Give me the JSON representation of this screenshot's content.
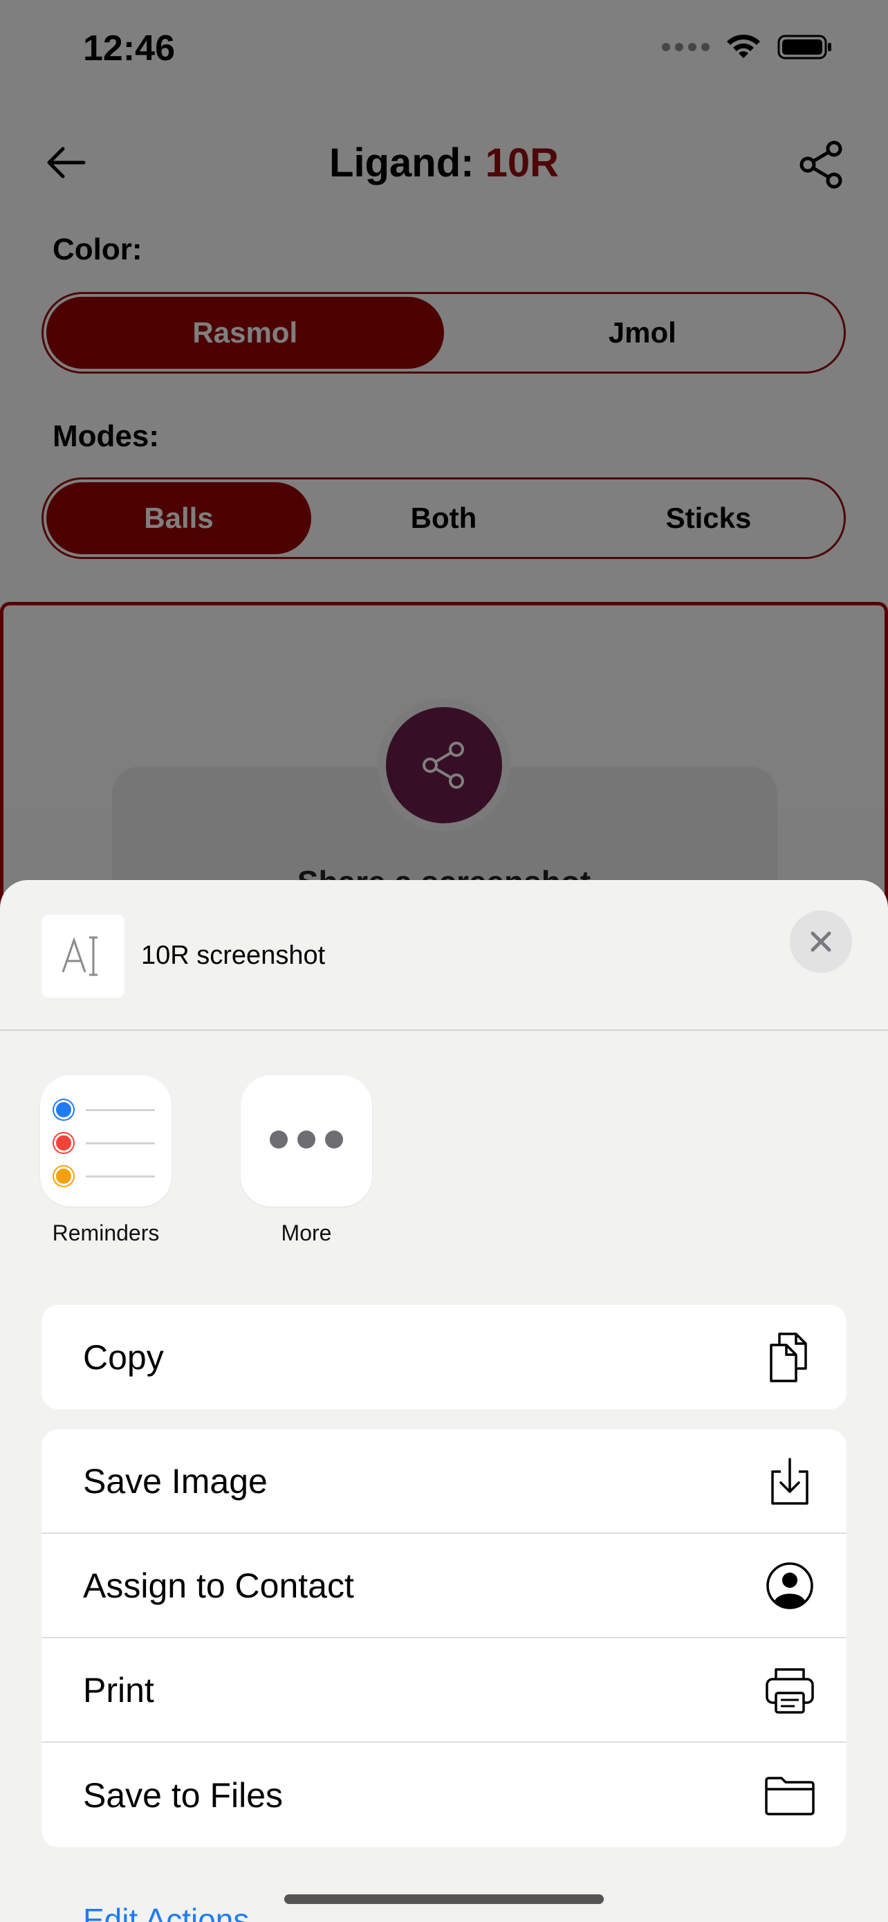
{
  "status_bar": {
    "time": "12:46"
  },
  "navbar": {
    "title_prefix": "Ligand:",
    "title_accent": "10R"
  },
  "color_section": {
    "label": "Color:",
    "options": [
      "Rasmol",
      "Jmol"
    ],
    "selected": "Rasmol"
  },
  "modes_section": {
    "label": "Modes:",
    "options": [
      "Balls",
      "Both",
      "Sticks"
    ],
    "selected": "Balls"
  },
  "callout": {
    "title": "Share a screenshot"
  },
  "share_sheet": {
    "file_title": "10R screenshot",
    "apps": [
      {
        "label": "Reminders",
        "icon": "reminders-icon"
      },
      {
        "label": "More",
        "icon": "more-icon"
      }
    ],
    "primary_action": {
      "label": "Copy",
      "icon": "copy-icon"
    },
    "actions": [
      {
        "label": "Save Image",
        "icon": "save-image-icon"
      },
      {
        "label": "Assign to Contact",
        "icon": "contact-icon"
      },
      {
        "label": "Print",
        "icon": "printer-icon"
      },
      {
        "label": "Save to Files",
        "icon": "folder-icon"
      }
    ],
    "edit_actions": "Edit Actions..."
  },
  "colors": {
    "accent": "#9b0f0f",
    "link": "#1f7cf2",
    "share_circle": "#6d1f4d"
  }
}
